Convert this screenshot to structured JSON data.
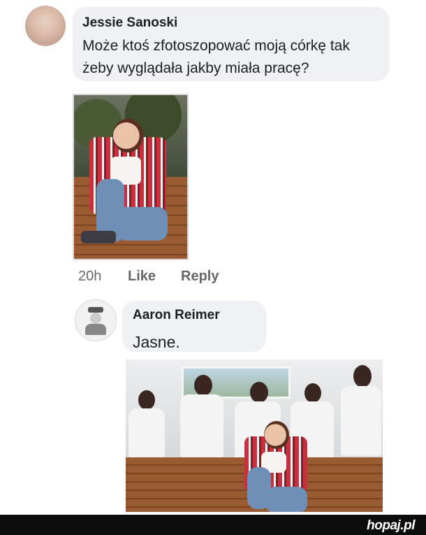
{
  "comments": [
    {
      "author": "Jessie Sanoski",
      "lines": [
        "Może ktoś zfotoszopować moją córkę tak",
        "żeby wyglądała jakby miała pracę?"
      ],
      "attachment": "photo",
      "meta": {
        "time": "20h",
        "like": "Like",
        "reply": "Reply"
      }
    },
    {
      "author": "Aaron Reimer",
      "text": "Jasne.",
      "attachment": "photo"
    }
  ],
  "footer": {
    "brand": "hopaj.pl",
    "background": "#0d0d0d"
  },
  "colors": {
    "bubble": "#eff1f4",
    "meta_text": "#65676b",
    "text": "#1c1e21"
  }
}
